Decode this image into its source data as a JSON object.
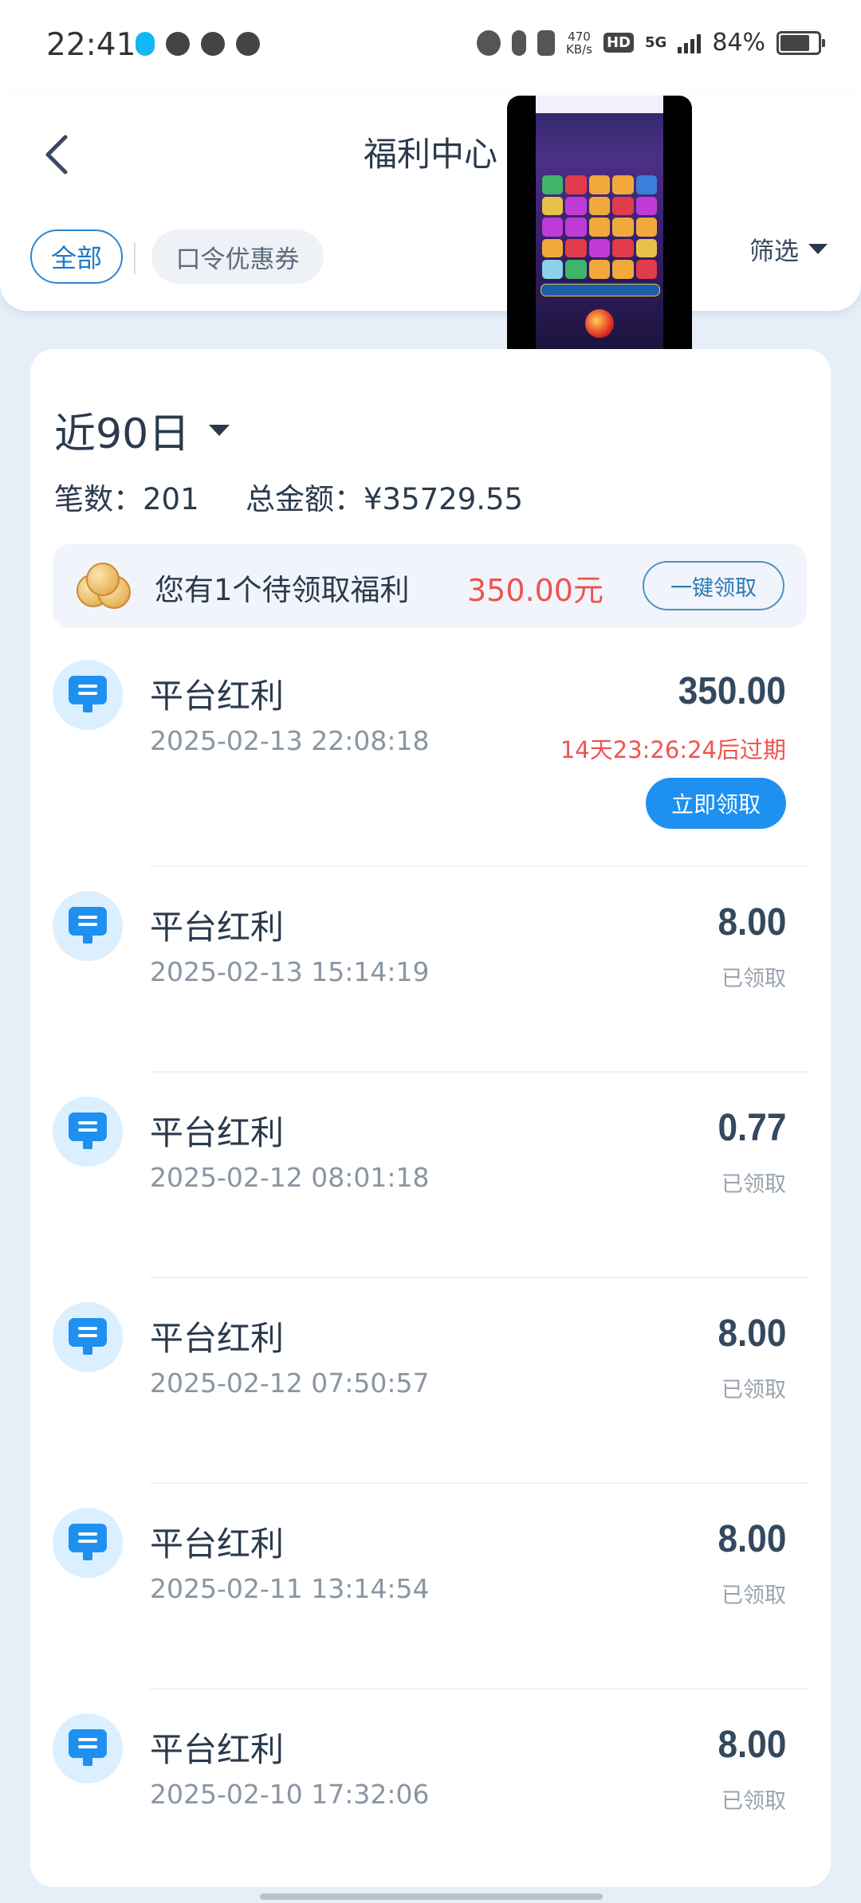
{
  "status_bar": {
    "time": "22:41",
    "speed_value": "470",
    "speed_unit": "KB/s",
    "hd": "HD",
    "network": "5G",
    "battery": "84%"
  },
  "header": {
    "title": "福利中心",
    "back_icon": "chevron-left-icon",
    "tabs": [
      {
        "label": "全部",
        "active": true
      },
      {
        "label": "口令优惠券",
        "active": false
      }
    ],
    "filter_label": "筛选"
  },
  "summary": {
    "period": "近90日",
    "count_label": "笔数：201",
    "total_label": "总金额：¥35729.55"
  },
  "banner": {
    "text": "您有1个待领取福利",
    "amount": "350.00元",
    "button": "一键领取"
  },
  "items": [
    {
      "name": "平台红利",
      "time": "2025-02-13 22:08:18",
      "amount": "350.00",
      "expire": "14天23:26:24后过期",
      "button": "立即领取"
    },
    {
      "name": "平台红利",
      "time": "2025-02-13 15:14:19",
      "amount": "8.00",
      "status": "已领取"
    },
    {
      "name": "平台红利",
      "time": "2025-02-12 08:01:18",
      "amount": "0.77",
      "status": "已领取"
    },
    {
      "name": "平台红利",
      "time": "2025-02-12 07:50:57",
      "amount": "8.00",
      "status": "已领取"
    },
    {
      "name": "平台红利",
      "time": "2025-02-11 13:14:54",
      "amount": "8.00",
      "status": "已领取"
    },
    {
      "name": "平台红利",
      "time": "2025-02-10 17:32:06",
      "amount": "8.00",
      "status": "已领取"
    }
  ],
  "colors": {
    "accent": "#1e90f0",
    "warning": "#ef5350",
    "background": "#e6eef8"
  }
}
